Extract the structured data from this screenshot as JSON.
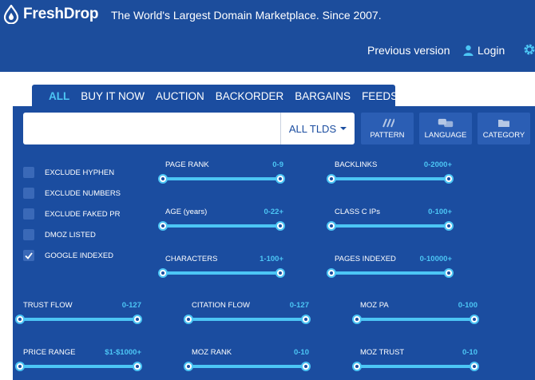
{
  "header": {
    "brand": "FreshDrop",
    "tagline": "The World's Largest Domain Marketplace. Since 2007.",
    "previous_version": "Previous version",
    "login": "Login"
  },
  "tabs": [
    {
      "label": "ALL",
      "active": true
    },
    {
      "label": "BUY IT NOW"
    },
    {
      "label": "AUCTION"
    },
    {
      "label": "BACKORDER"
    },
    {
      "label": "BARGAINS"
    },
    {
      "label": "FEEDS"
    }
  ],
  "search": {
    "value": "",
    "tld_label": "ALL TLDS"
  },
  "filter_buttons": [
    {
      "label": "PATTERN",
      "icon": "pattern-icon"
    },
    {
      "label": "LANGUAGE",
      "icon": "language-icon"
    },
    {
      "label": "CATEGORY",
      "icon": "category-icon"
    }
  ],
  "checkboxes": [
    {
      "label": "EXCLUDE HYPHEN",
      "checked": false
    },
    {
      "label": "EXCLUDE NUMBERS",
      "checked": false
    },
    {
      "label": "EXCLUDE FAKED PR",
      "checked": false
    },
    {
      "label": "DMOZ LISTED",
      "checked": false
    },
    {
      "label": "GOOGLE INDEXED",
      "checked": true
    }
  ],
  "sliders": [
    {
      "label": "PAGE RANK",
      "value": "0-9"
    },
    {
      "label": "BACKLINKS",
      "value": "0-2000+"
    },
    {
      "label": "AGE (years)",
      "value": "0-22+"
    },
    {
      "label": "CLASS C IPs",
      "value": "0-100+"
    },
    {
      "label": "CHARACTERS",
      "value": "1-100+"
    },
    {
      "label": "PAGES INDEXED",
      "value": "0-10000+"
    },
    {
      "label": "TRUST FLOW",
      "value": "0-127"
    },
    {
      "label": "CITATION FLOW",
      "value": "0-127"
    },
    {
      "label": "MOZ PA",
      "value": "0-100"
    },
    {
      "label": "PRICE RANGE",
      "value": "$1-$1000+"
    },
    {
      "label": "MOZ RANK",
      "value": "0-10"
    },
    {
      "label": "MOZ TRUST",
      "value": "0-10"
    }
  ],
  "colors": {
    "background": "#1c4d9c",
    "panel": "#1b4da0",
    "accent": "#4cc6f5"
  }
}
